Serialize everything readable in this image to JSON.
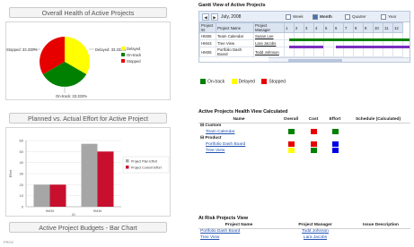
{
  "left": {
    "health_title": "Overall Health of Active Projects",
    "effort_title": "Planned vs. Actual Effort for Active Project",
    "budget_title": "Active Project Budgets - Bar Chart",
    "footer": "PROC"
  },
  "pie": {
    "labels": {
      "stopped": "Stopped: 33.333%",
      "delayed": "Delayed: 33.333%",
      "ontrack": "On-track: 33.333%"
    },
    "legend": [
      {
        "name": "Delayed",
        "color": "#ffff00"
      },
      {
        "name": "On-track",
        "color": "#008000"
      },
      {
        "name": "Stopped",
        "color": "#e60000"
      }
    ]
  },
  "chart_data": {
    "type": "bar",
    "title": "",
    "categories": [
      "HM35",
      "HM36"
    ],
    "series": [
      {
        "name": "Project Plan Effort",
        "values": [
          20,
          57
        ],
        "color": "#a6a6a6"
      },
      {
        "name": "Project Current Effort",
        "values": [
          20,
          50
        ],
        "color": "#c8102e"
      }
    ],
    "ylim": [
      0,
      60
    ],
    "yticks": [
      "60",
      "50",
      "40",
      "30",
      "20",
      "10",
      "0"
    ],
    "ylabel": "Effort",
    "xlabel": "ID",
    "legend_position": "right"
  },
  "gantt": {
    "title": "Gantt View of Active Projects",
    "month": "July, 2008",
    "views": [
      "Week",
      "Month",
      "Quarter",
      "Year"
    ],
    "selected_view": "Month",
    "columns": [
      "Project ID",
      "Project Name",
      "Project Manager",
      "1",
      "2",
      "3",
      "4",
      "5",
      "6",
      "7",
      "8",
      "9",
      "10",
      "11",
      "12"
    ],
    "rows": [
      {
        "id": "HM36",
        "name": "Team Calendar",
        "manager": "Susan Lee"
      },
      {
        "id": "HM43",
        "name": "Tree View",
        "manager": "Lara Jacobs"
      },
      {
        "id": "HM35",
        "name": "Portfolio Dash Board",
        "manager": "Todd Johnson"
      }
    ]
  },
  "status_legend": [
    {
      "label": "On-track",
      "color": "#008000"
    },
    {
      "label": "Delayed",
      "color": "#ffff00"
    },
    {
      "label": "Stopped",
      "color": "#e60000"
    }
  ],
  "health": {
    "title": "Active Projects Health View Calculated",
    "columns": [
      "Name",
      "Overall",
      "Cost",
      "Effort",
      "Schedule (Calculated)"
    ],
    "groups": [
      {
        "name": "Custom",
        "items": [
          {
            "name": "Team Calendar",
            "colors": [
              "#008000",
              "#e60000",
              "#008000"
            ]
          }
        ]
      },
      {
        "name": "Product",
        "items": [
          {
            "name": "Portfolio Dash Board",
            "colors": [
              "#e60000",
              "#e60000",
              "#0000e6"
            ]
          },
          {
            "name": "Tree View",
            "colors": [
              "#ffff00",
              "#008000",
              "#0000e6"
            ]
          }
        ]
      }
    ]
  },
  "risk": {
    "title": "At Risk Projects View",
    "columns": [
      "Project Name",
      "Project Manager",
      "Issue Description"
    ],
    "rows": [
      {
        "name": "Portfolio Dash Board",
        "manager": "Todd Johnson"
      },
      {
        "name": "Tree View",
        "manager": "Lara Jacobs"
      }
    ]
  }
}
